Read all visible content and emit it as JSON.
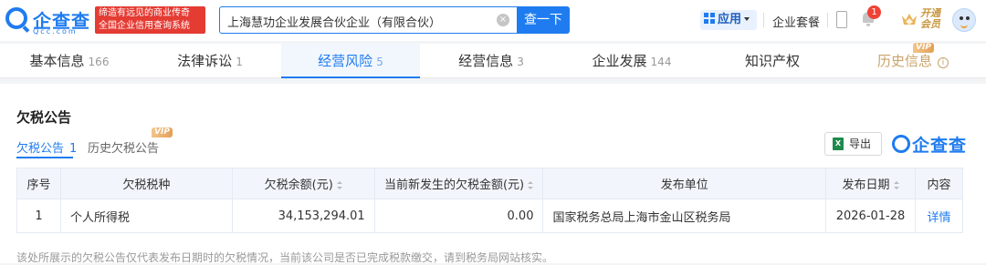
{
  "header": {
    "logo_text": "企查查",
    "logo_domain": "Qcc.com",
    "slogan_line1": "缔造有远见的商业传奇",
    "slogan_line2": "全国企业信用查询系统",
    "search_value": "上海慧功企业发展合伙企业（有限合伙）",
    "search_button": "查一下",
    "app_button": "应用",
    "suite_link": "企业套餐",
    "notification_count": "1",
    "vip_line1": "开通",
    "vip_line2": "会员"
  },
  "tabs": [
    {
      "label": "基本信息",
      "count": "166"
    },
    {
      "label": "法律诉讼",
      "count": "1"
    },
    {
      "label": "经营风险",
      "count": "5"
    },
    {
      "label": "经营信息",
      "count": "3"
    },
    {
      "label": "企业发展",
      "count": "144"
    },
    {
      "label": "知识产权",
      "count": ""
    },
    {
      "label": "历史信息",
      "count": ""
    }
  ],
  "vip_tag": "VIP",
  "section": {
    "title": "欠税公告",
    "subtab_current": "欠税公告",
    "subtab_current_count": "1",
    "subtab_history": "历史欠税公告",
    "export_label": "导出",
    "excel_glyph": "X",
    "brand_text": "企查查"
  },
  "table": {
    "headers": [
      "序号",
      "欠税税种",
      "欠税余额(元)",
      "当前新发生的欠税金额(元)",
      "发布单位",
      "发布日期",
      "内容"
    ],
    "rows": [
      [
        "1",
        "个人所得税",
        "34,153,294.01",
        "0.00",
        "国家税务总局上海市金山区税务局",
        "2026-01-28",
        "详情"
      ]
    ]
  },
  "footnote": "该处所展示的欠税公告仅代表发布日期时的欠税情况，当前该公司是否已完成税款缴交，请到税务局网站核实。",
  "colors": {
    "primary": "#1f7cf0",
    "slogan_bg": "#e43b33",
    "vip_gold": "#c9a36a"
  }
}
